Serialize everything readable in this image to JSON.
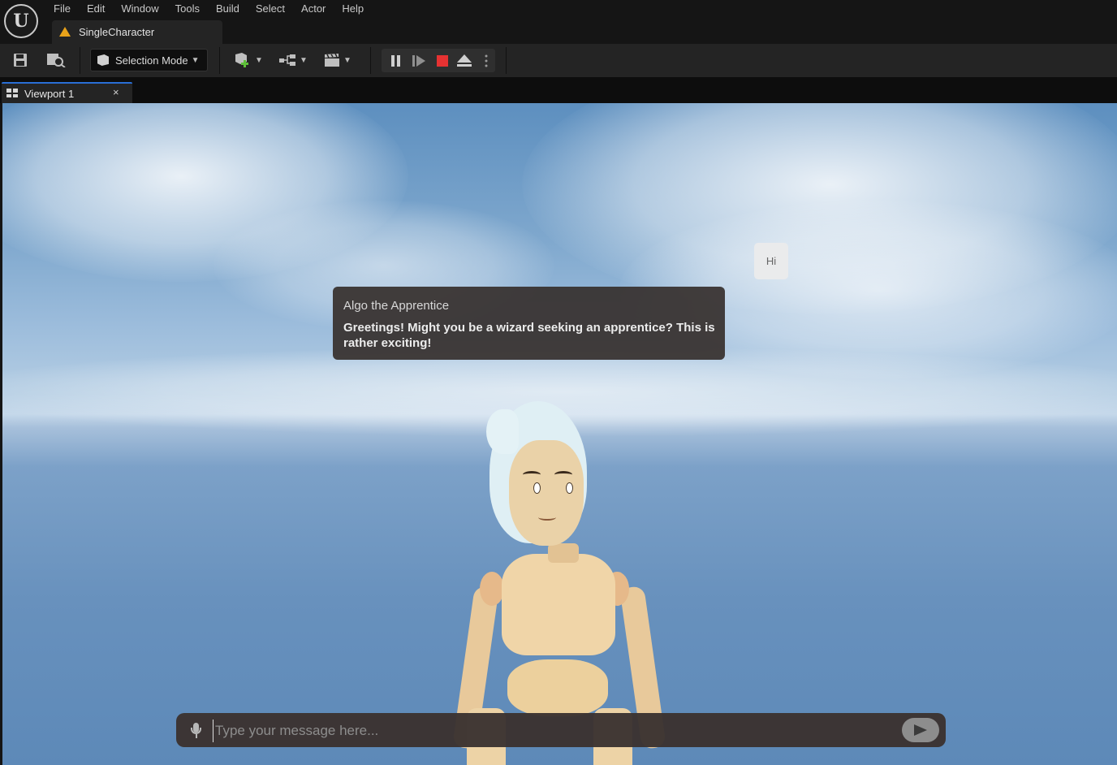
{
  "app": {
    "menu": [
      "File",
      "Edit",
      "Window",
      "Tools",
      "Build",
      "Select",
      "Actor",
      "Help"
    ],
    "document_tab": "SingleCharacter"
  },
  "toolbar": {
    "selection_mode": "Selection Mode"
  },
  "viewport": {
    "tab_label": "Viewport 1",
    "close_glyph": "×"
  },
  "dialogue": {
    "npc_name": "Algo the Apprentice",
    "npc_message": "Greetings! Might you be a wizard seeking an apprentice? This is rather exciting!",
    "user_message": "Hi"
  },
  "chat": {
    "placeholder": "Type your message here..."
  },
  "colors": {
    "stop": "#e63232",
    "warning": "#e8a21a",
    "tab_accent": "#2a6fd6"
  }
}
